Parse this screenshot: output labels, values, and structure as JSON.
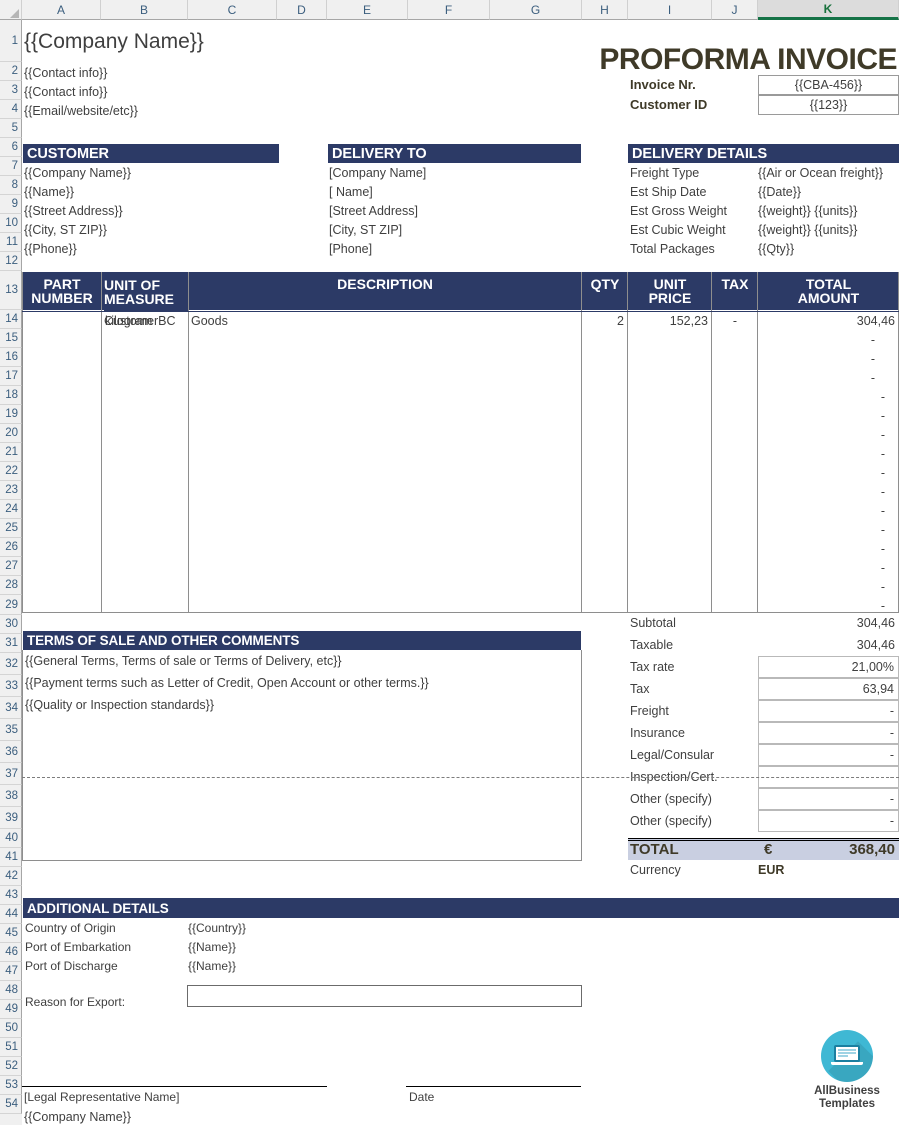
{
  "spreadsheet": {
    "columns": [
      "A",
      "B",
      "C",
      "D",
      "E",
      "F",
      "G",
      "H",
      "I",
      "J",
      "K"
    ],
    "selected_column": "K",
    "rows": [
      1,
      2,
      3,
      4,
      5,
      6,
      7,
      8,
      9,
      10,
      11,
      12,
      13,
      14,
      15,
      16,
      17,
      18,
      19,
      20,
      21,
      22,
      23,
      24,
      25,
      26,
      27,
      28,
      29,
      30,
      31,
      32,
      33,
      34,
      35,
      36,
      37,
      38,
      39,
      40,
      41,
      42,
      43,
      44,
      45,
      46,
      47,
      48,
      49,
      50,
      51,
      52,
      53,
      54
    ]
  },
  "colors": {
    "navy": "#2c3a66",
    "title_brown": "#3f3a28",
    "total_fill": "#c9cfe1",
    "logo_teal": "#3fb8d4",
    "selected_green": "#157347"
  },
  "header": {
    "company_name": "{{Company Name}}",
    "contact_1": "{{Contact info}}",
    "contact_2": "{{Contact info}}",
    "email_website": "{{Email/website/etc}}",
    "doc_title": "PROFORMA INVOICE",
    "invoice_nr_label": "Invoice Nr.",
    "invoice_nr_value": "{{CBA-456}}",
    "customer_id_label": "Customer ID",
    "customer_id_value": "{{123}}"
  },
  "customer": {
    "heading": "CUSTOMER",
    "lines": [
      "{{Company Name}}",
      "{{Name}}",
      "{{Street Address}}",
      "{{City, ST  ZIP}}",
      "{{Phone}}"
    ]
  },
  "delivery_to": {
    "heading": "DELIVERY TO",
    "lines": [
      "[Company Name]",
      "[ Name]",
      "[Street Address]",
      "[City, ST  ZIP]",
      "[Phone]"
    ]
  },
  "delivery_details": {
    "heading": "DELIVERY DETAILS",
    "rows": [
      {
        "label": "Freight Type",
        "value": "{{Air or Ocean freight}}"
      },
      {
        "label": "Est Ship Date",
        "value": "{{Date}}"
      },
      {
        "label": "Est Gross Weight",
        "value": "{{weight}} {{units}}"
      },
      {
        "label": "Est Cubic Weight",
        "value": "{{weight}} {{units}}"
      },
      {
        "label": "Total Packages",
        "value": "{{Qty}}"
      }
    ]
  },
  "line_items": {
    "columns": [
      "PART NUMBER",
      "UNIT OF MEASURE",
      "DESCRIPTION",
      "QTY",
      "UNIT PRICE",
      "TAX",
      "TOTAL AMOUNT"
    ],
    "col_part_number_l1": "PART",
    "col_part_number_l2": "NUMBER",
    "col_unit_l1": "UNIT OF",
    "col_unit_l2": "MEASURE",
    "col_description": "DESCRIPTION",
    "col_qty": "QTY",
    "col_unit_price_l1": "UNIT",
    "col_unit_price_l2": "PRICE",
    "col_tax": "TAX",
    "col_total_l1": "TOTAL",
    "col_total_l2": "AMOUNT",
    "rows": [
      {
        "part_number": "CustomerBC",
        "unit_of_measure": "kilogram",
        "description": "Goods",
        "qty": "2",
        "unit_price": "152,23",
        "tax": "-",
        "total_amount": "304,46"
      }
    ],
    "empty_row_dash": "-",
    "empty_row_count": 15
  },
  "terms": {
    "heading": "TERMS OF SALE AND OTHER COMMENTS",
    "lines": [
      "{{General Terms, Terms of sale or Terms of Delivery, etc}}",
      "{{Payment terms such as Letter of Credit, Open Account or other terms.}}",
      "{{Quality or Inspection standards}}"
    ]
  },
  "totals": {
    "rows": [
      {
        "label": "Subtotal",
        "value": "304,46",
        "boxed": false
      },
      {
        "label": "Taxable",
        "value": "304,46",
        "boxed": false
      },
      {
        "label": "Tax rate",
        "value": "21,00%",
        "boxed": true
      },
      {
        "label": "Tax",
        "value": "63,94",
        "boxed": true
      },
      {
        "label": "Freight",
        "value": "-",
        "boxed": true
      },
      {
        "label": "Insurance",
        "value": "-",
        "boxed": true
      },
      {
        "label": "Legal/Consular",
        "value": "-",
        "boxed": true
      },
      {
        "label": "Inspection/Cert.",
        "value": "-",
        "boxed": true
      },
      {
        "label": "Other (specify)",
        "value": "-",
        "boxed": true
      },
      {
        "label": "Other (specify)",
        "value": "-",
        "boxed": true
      }
    ],
    "total_label": "TOTAL",
    "total_currency_symbol": "€",
    "total_value": "368,40",
    "currency_label": "Currency",
    "currency_value": "EUR"
  },
  "additional": {
    "heading": "ADDITIONAL DETAILS",
    "rows": [
      {
        "label": "Country of Origin",
        "value": "{{Country}}"
      },
      {
        "label": "Port of Embarkation",
        "value": "{{Name}}"
      },
      {
        "label": "Port of Discharge",
        "value": "{{Name}}"
      }
    ],
    "reason_label": "Reason for Export:",
    "reason_value": ""
  },
  "signature": {
    "rep_name": "[Legal Representative Name]",
    "date_label": "Date",
    "company_name": "{{Company Name}}"
  },
  "logo": {
    "line1": "AllBusiness",
    "line2": "Templates"
  }
}
